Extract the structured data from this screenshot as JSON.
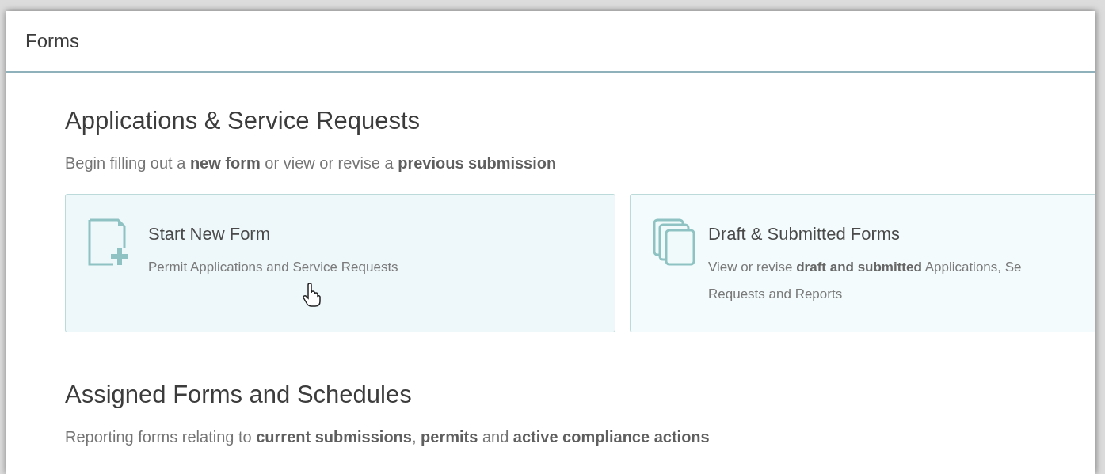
{
  "window": {
    "title": "Forms"
  },
  "sections": [
    {
      "heading": "Applications & Service Requests",
      "subtitle": "Begin filling out a **new form** or view or revise a **previous submission**",
      "cards": [
        {
          "kind": "new",
          "title": "Start New Form",
          "description_lines": [
            "Permit Applications and Service Requests"
          ],
          "hovered": true
        },
        {
          "kind": "stack",
          "title": "Draft & Submitted Forms",
          "description_lines": [
            "View or revise **draft and submitted** Applications, Se",
            "Requests and Reports"
          ],
          "hovered": false
        }
      ]
    },
    {
      "heading": "Assigned Forms and Schedules",
      "subtitle": "Reporting forms relating to **current submissions**, **permits** and **active compliance actions**"
    }
  ]
}
